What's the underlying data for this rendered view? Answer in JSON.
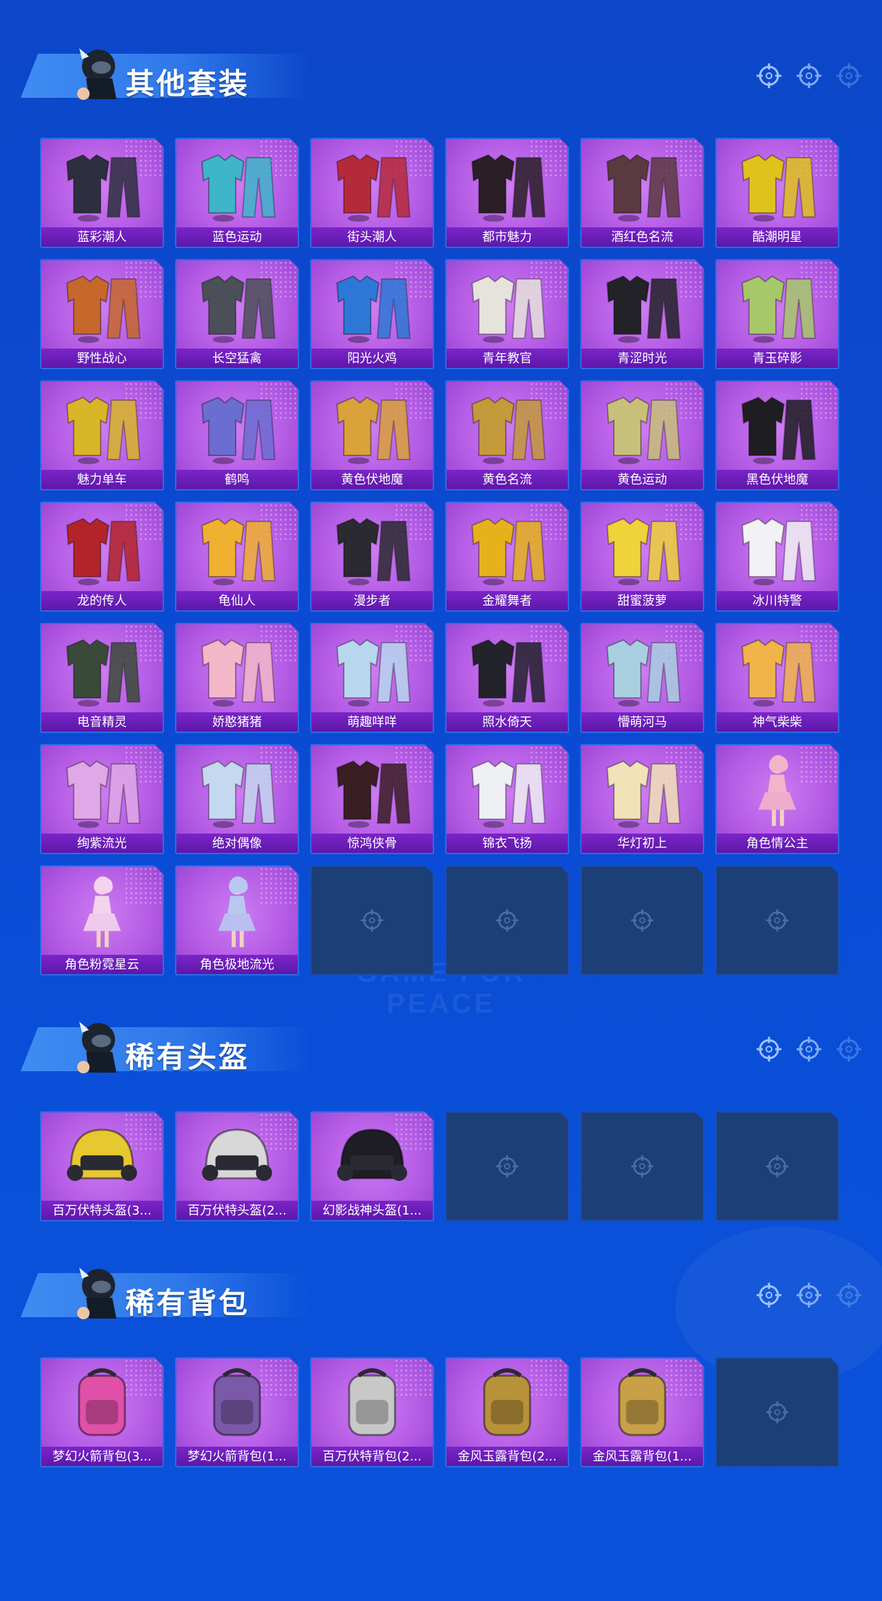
{
  "brand": {
    "watermark": "GAME FOR PEACE"
  },
  "colors": {
    "background": "#0b4ad2",
    "tile": "#b55de6",
    "label_bar": "#6a1fb8",
    "empty_tile": "#1d3f78"
  },
  "sections": [
    {
      "title": "其他套装",
      "items": [
        {
          "label": "蓝彩潮人",
          "icon": "outfit-icon",
          "art": "#2d2f40"
        },
        {
          "label": "蓝色运动",
          "icon": "outfit-icon",
          "art": "#3fb5c9"
        },
        {
          "label": "街头潮人",
          "icon": "outfit-icon",
          "art": "#b52a3a"
        },
        {
          "label": "都市魅力",
          "icon": "outfit-icon",
          "art": "#2a1f25"
        },
        {
          "label": "酒红色名流",
          "icon": "outfit-icon",
          "art": "#5a3a40"
        },
        {
          "label": "酷潮明星",
          "icon": "outfit-icon",
          "art": "#e0c21c"
        },
        {
          "label": "野性战心",
          "icon": "outfit-icon",
          "art": "#c6682c"
        },
        {
          "label": "长空猛禽",
          "icon": "outfit-icon",
          "art": "#4b5058"
        },
        {
          "label": "阳光火鸡",
          "icon": "outfit-icon",
          "art": "#2d78d6"
        },
        {
          "label": "青年教官",
          "icon": "outfit-icon",
          "art": "#e6e2dc"
        },
        {
          "label": "青涩时光",
          "icon": "outfit-icon",
          "art": "#222228"
        },
        {
          "label": "青玉碎影",
          "icon": "outfit-icon",
          "art": "#a7c86a"
        },
        {
          "label": "魅力单车",
          "icon": "outfit-icon",
          "art": "#d9b528"
        },
        {
          "label": "鹤鸣",
          "icon": "outfit-icon",
          "art": "#6b6ed0"
        },
        {
          "label": "黄色伏地魔",
          "icon": "outfit-icon",
          "art": "#d9a23a"
        },
        {
          "label": "黄色名流",
          "icon": "outfit-icon",
          "art": "#c49a3a"
        },
        {
          "label": "黄色运动",
          "icon": "outfit-icon",
          "art": "#c8c07a"
        },
        {
          "label": "黑色伏地魔",
          "icon": "outfit-icon",
          "art": "#1e1e22"
        },
        {
          "label": "龙的传人",
          "icon": "outfit-icon",
          "art": "#b3242a"
        },
        {
          "label": "龟仙人",
          "icon": "outfit-icon",
          "art": "#f0b030"
        },
        {
          "label": "漫步者",
          "icon": "outfit-icon",
          "art": "#2a2a30"
        },
        {
          "label": "金耀舞者",
          "icon": "outfit-icon",
          "art": "#e6b21c"
        },
        {
          "label": "甜蜜菠萝",
          "icon": "outfit-icon",
          "art": "#f0d23a"
        },
        {
          "label": "冰川特警",
          "icon": "outfit-icon",
          "art": "#f2f2f4"
        },
        {
          "label": "电音精灵",
          "icon": "outfit-icon",
          "art": "#3a4a38"
        },
        {
          "label": "娇憨猪猪",
          "icon": "outfit-icon",
          "art": "#f4b8c8"
        },
        {
          "label": "萌趣咩咩",
          "icon": "outfit-icon",
          "art": "#b8d6ee"
        },
        {
          "label": "照水倚天",
          "icon": "outfit-icon",
          "art": "#23232c"
        },
        {
          "label": "懵萌河马",
          "icon": "outfit-icon",
          "art": "#a8d0e0"
        },
        {
          "label": "神气柴柴",
          "icon": "outfit-icon",
          "art": "#f0b44a"
        },
        {
          "label": "绚紫流光",
          "icon": "outfit-icon",
          "art": "#e0a8e6"
        },
        {
          "label": "绝对偶像",
          "icon": "outfit-icon",
          "art": "#c4d8f0"
        },
        {
          "label": "惊鸿侠骨",
          "icon": "outfit-icon",
          "art": "#3a1e24"
        },
        {
          "label": "锦衣飞扬",
          "icon": "outfit-icon",
          "art": "#eef0f4"
        },
        {
          "label": "华灯初上",
          "icon": "outfit-icon",
          "art": "#f2e2b8"
        },
        {
          "label": "角色情公主",
          "icon": "character-icon",
          "art": "#f2b4c8"
        },
        {
          "label": "角色粉霓星云",
          "icon": "character-icon",
          "art": "#f4d4ec"
        },
        {
          "label": "角色极地流光",
          "icon": "character-icon",
          "art": "#b8c8f0"
        }
      ],
      "empty_slots": 4
    },
    {
      "title": "稀有头盔",
      "items": [
        {
          "label": "百万伏特头盔(3...",
          "icon": "helmet-icon",
          "art": "#e8c830"
        },
        {
          "label": "百万伏特头盔(2...",
          "icon": "helmet-icon",
          "art": "#d8d8d8"
        },
        {
          "label": "幻影战神头盔(1...",
          "icon": "helmet-icon",
          "art": "#1e1e24"
        }
      ],
      "empty_slots": 3
    },
    {
      "title": "稀有背包",
      "items": [
        {
          "label": "梦幻火箭背包(3...",
          "icon": "backpack-icon",
          "art": "#e050a8"
        },
        {
          "label": "梦幻火箭背包(1...",
          "icon": "backpack-icon",
          "art": "#7a5aa8"
        },
        {
          "label": "百万伏特背包(2...",
          "icon": "backpack-icon",
          "art": "#c8c8c8"
        },
        {
          "label": "金风玉露背包(2...",
          "icon": "backpack-icon",
          "art": "#b8923a"
        },
        {
          "label": "金风玉露背包(1...",
          "icon": "backpack-icon",
          "art": "#c8a048"
        }
      ],
      "empty_slots": 1
    }
  ]
}
